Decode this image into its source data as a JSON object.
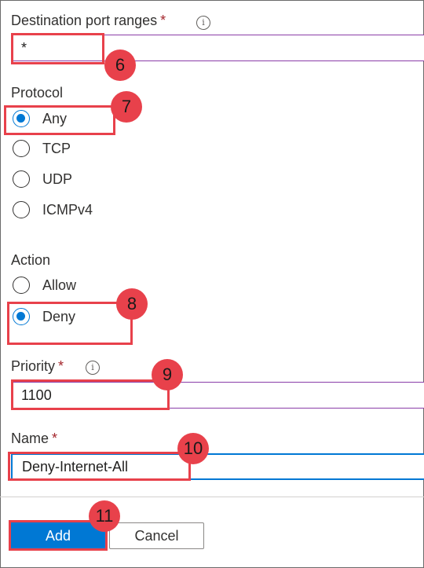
{
  "fields": {
    "destination_port_ranges": {
      "label": "Destination port ranges",
      "required_mark": "*",
      "value": "*"
    },
    "protocol": {
      "label": "Protocol",
      "options": [
        "Any",
        "TCP",
        "UDP",
        "ICMPv4"
      ],
      "selected": "Any"
    },
    "action": {
      "label": "Action",
      "options": [
        "Allow",
        "Deny"
      ],
      "selected": "Deny"
    },
    "priority": {
      "label": "Priority",
      "required_mark": "*",
      "value": "1100"
    },
    "name": {
      "label": "Name",
      "required_mark": "*",
      "value": "Deny-Internet-All"
    }
  },
  "info_icon_glyph": "i",
  "buttons": {
    "add": "Add",
    "cancel": "Cancel"
  },
  "callouts": [
    "6",
    "7",
    "8",
    "9",
    "10",
    "11"
  ],
  "colors": {
    "accent": "#0078d4",
    "callout": "#e8414b",
    "required": "#a4262c",
    "input_border": "#8a3da8"
  }
}
